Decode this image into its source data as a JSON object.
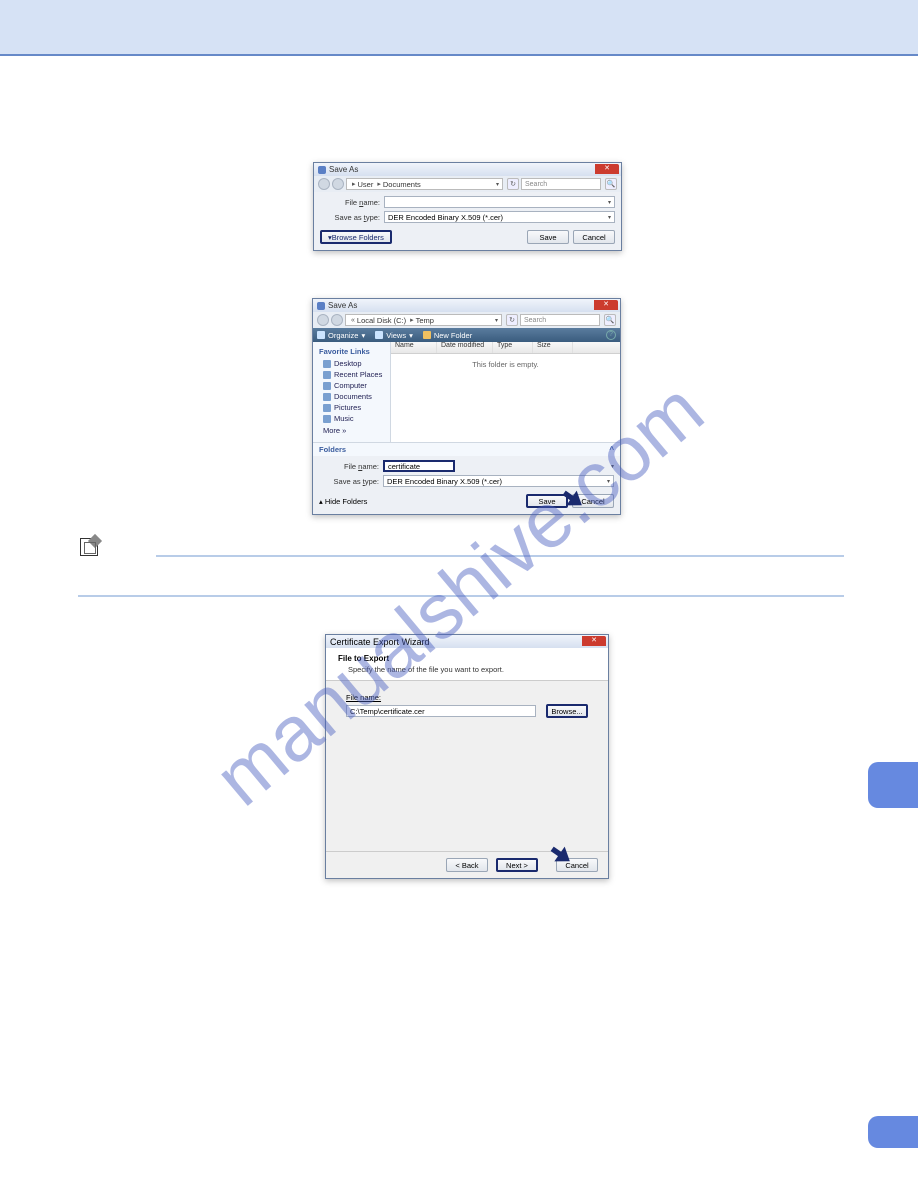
{
  "dialog1": {
    "title": "Save As",
    "path": [
      "User",
      "Documents"
    ],
    "search_placeholder": "Search",
    "file_name_label": "File name:",
    "file_name_value": "",
    "save_type_label": "Save as type:",
    "save_type_value": "DER Encoded Binary X.509 (*.cer)",
    "browse_folders": "Browse Folders",
    "save": "Save",
    "cancel": "Cancel"
  },
  "dialog2": {
    "title": "Save As",
    "path": [
      "Local Disk (C:)",
      "Temp"
    ],
    "search_placeholder": "Search",
    "toolbar": {
      "organize": "Organize",
      "views": "Views",
      "newfolder": "New Folder"
    },
    "sidebar_header": "Favorite Links",
    "sidebar_items": [
      "Desktop",
      "Recent Places",
      "Computer",
      "Documents",
      "Pictures",
      "Music"
    ],
    "sidebar_more": "More  »",
    "columns": [
      "Name",
      "Date modified",
      "Type",
      "Size"
    ],
    "empty": "This folder is empty.",
    "folders_label": "Folders",
    "file_name_label": "File name:",
    "file_name_value": "certificate",
    "save_type_label": "Save as type:",
    "save_type_value": "DER Encoded Binary X.509 (*.cer)",
    "hide_folders": "Hide Folders",
    "save": "Save",
    "cancel": "Cancel"
  },
  "dialog3": {
    "title": "Certificate Export Wizard",
    "heading": "File to Export",
    "subheading": "Specify the name of the file you want to export.",
    "file_label": "File name:",
    "file_value": "C:\\Temp\\certificate.cer",
    "browse": "Browse...",
    "back": "< Back",
    "next": "Next >",
    "cancel": "Cancel"
  }
}
